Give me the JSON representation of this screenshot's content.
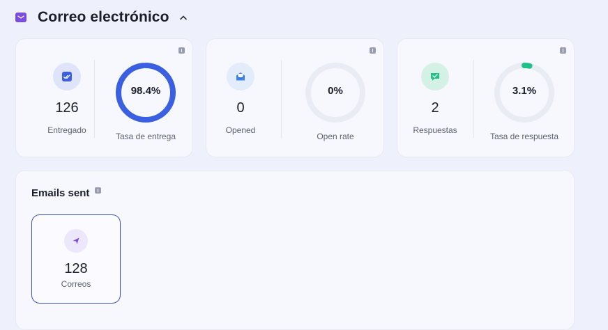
{
  "header": {
    "title": "Correo electrónico",
    "icon": "mail-icon",
    "accent": "#7c4ddb"
  },
  "cards": [
    {
      "stat_value": "126",
      "stat_label": "Entregado",
      "stat_icon": "double-check-icon",
      "rate_value": "98.4%",
      "rate_label": "Tasa de entrega",
      "rate_percent": 98.4,
      "ring_color": "#3a5fe0",
      "icon_bg": "#dfe4fb",
      "icon_color": "#3a5fe0"
    },
    {
      "stat_value": "0",
      "stat_label": "Opened",
      "stat_icon": "open-envelope-icon",
      "rate_value": "0%",
      "rate_label": "Open rate",
      "rate_percent": 0,
      "ring_color": "#3a86f0",
      "icon_bg": "#e2ecfb",
      "icon_color": "#3a86f0"
    },
    {
      "stat_value": "2",
      "stat_label": "Respuestas",
      "stat_icon": "reply-chat-icon",
      "rate_value": "3.1%",
      "rate_label": "Tasa de respuesta",
      "rate_percent": 3.1,
      "ring_color": "#1fc08a",
      "icon_bg": "#d4f1e6",
      "icon_color": "#1fc08a"
    }
  ],
  "emails_sent": {
    "title": "Emails sent",
    "value": "128",
    "label": "Correos",
    "icon": "send-icon",
    "icon_color": "#7c4ddb"
  }
}
